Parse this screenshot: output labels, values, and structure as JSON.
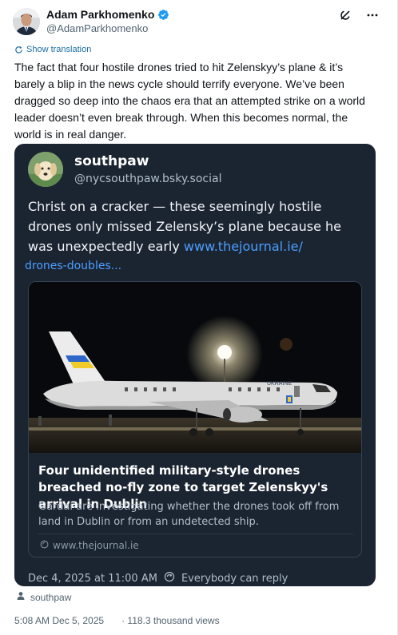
{
  "author": {
    "name": "Adam Parkhomenko",
    "handle": "@AdamParkhomenko"
  },
  "icons": {
    "verified": "verified-badge-icon",
    "grok": "grok-icon",
    "more": "more-icon",
    "translate": "translate-icon",
    "link": "link-icon",
    "globe": "globe-icon",
    "person": "person-icon"
  },
  "translation_label": "Show translation",
  "tweet_text": "The fact that four hostile drones tried to hit Zelenskyy’s plane & it’s barely a blip in the news cycle should terrify everyone. We’ve been dragged so deep into the chaos era that an attempted strike on a world leader doesn’t even break through. When this becomes normal, the world is in real danger.",
  "quote": {
    "name": "southpaw",
    "handle": "@nycsouthpaw.bsky.social",
    "text": "Christ on a cracker — these seemingly hostile drones only missed Zelensky’s plane because he was unexpectedly early ",
    "link_text": "www.thejournal.ie/",
    "link_text_2": "drones-doubles...",
    "card": {
      "image_label": "UKRAINE",
      "title": "Four unidentified military-style drones breached no-fly zone to target Zelenskyy's arrival in Dublin",
      "description": "Gardaí are investigating whether the drones took off from land in Dublin or from an undetected ship.",
      "domain": "www.thejournal.ie"
    },
    "timestamp": "Dec 4, 2025 at 11:00 AM",
    "reply_setting": "Everybody can reply"
  },
  "reposter": "southpaw",
  "meta": {
    "time": "5:08 AM Dec 5, 2025",
    "views": "· 118.3 thousand views"
  },
  "colors": {
    "link_blue": "#1d6fa5",
    "verified_blue": "#1d9bf0",
    "quote_bg": "#1b2532",
    "quote_link": "#4c9dff"
  }
}
